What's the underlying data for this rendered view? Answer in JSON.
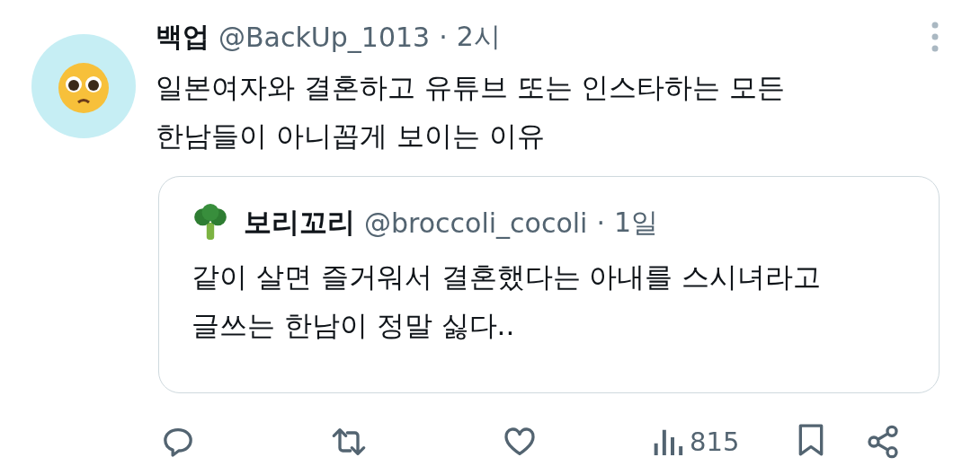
{
  "tweet": {
    "author": "백업",
    "handle": "@BackUp_1013",
    "separator": "·",
    "time": "2시",
    "text": [
      "일본여자와 결혼하고 유튜브 또는 인스타하는 모든",
      "한남들이 아니꼽게 보이는 이유"
    ]
  },
  "quote": {
    "author": "보리꼬리",
    "handle": "@broccoli_cocoli",
    "separator": "·",
    "time": "1일",
    "text": [
      "같이 살면 즐거워서 결혼했다는 아내를 스시녀라고",
      "글쓰는 한남이 정말 싫다.."
    ]
  },
  "actions": [
    {
      "kind": "reply"
    },
    {
      "kind": "repost"
    },
    {
      "kind": "like"
    },
    {
      "kind": "views",
      "count": "815"
    },
    {
      "kind": "bookmark"
    },
    {
      "kind": "share"
    }
  ]
}
